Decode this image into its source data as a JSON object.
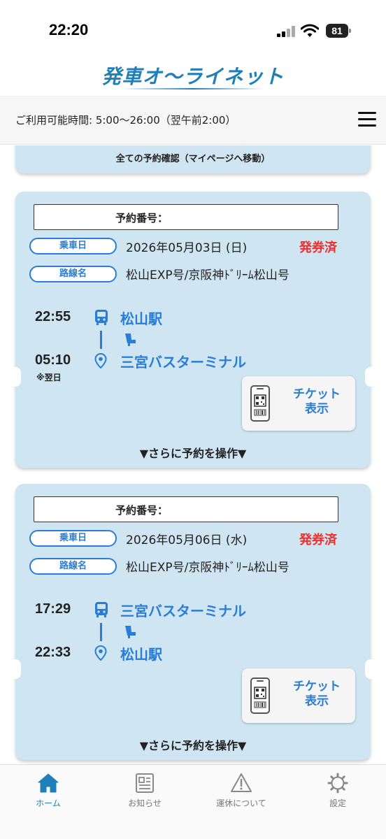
{
  "status_bar": {
    "time": "22:20",
    "battery": "81"
  },
  "app": {
    "logo_text": "発車オ〜ライネット"
  },
  "hours": {
    "text": "ご利用可能時間: 5:00〜26:00（翌午前2:00）"
  },
  "all_reservations_button": "全ての予約確認（マイページへ移動）",
  "labels": {
    "reservation_number": "予約番号：",
    "boarding_date": "乗車日",
    "route_name": "路線名",
    "ticket_button": "チケット表示",
    "ticket_line1": "チケット",
    "ticket_line2": "表示",
    "more_operations": "▼さらに予約を操作▼"
  },
  "reservations": [
    {
      "date": "2026年05月03日 (日)",
      "status": "発券済",
      "route": "松山EXP号/京阪神ﾄﾞﾘｰﾑ松山号",
      "departure_time": "22:55",
      "departure_stop": "松山駅",
      "arrival_time": "05:10",
      "arrival_note": "※翌日",
      "arrival_stop": "三宮バスターミナル"
    },
    {
      "date": "2026年05月06日 (水)",
      "status": "発券済",
      "route": "松山EXP号/京阪神ﾄﾞﾘｰﾑ松山号",
      "departure_time": "17:29",
      "departure_stop": "三宮バスターミナル",
      "arrival_time": "22:33",
      "arrival_note": "",
      "arrival_stop": "松山駅"
    }
  ],
  "tabs": [
    {
      "label": "ホーム",
      "icon": "home-icon",
      "active": true
    },
    {
      "label": "お知らせ",
      "icon": "news-icon",
      "active": false
    },
    {
      "label": "運休について",
      "icon": "warning-icon",
      "active": false
    },
    {
      "label": "設定",
      "icon": "gear-icon",
      "active": false
    }
  ],
  "colors": {
    "brand": "#1f7fb8",
    "accent": "#2a7dd6",
    "card_background": "#cfe6f2",
    "issued_status": "#f02e2e"
  }
}
